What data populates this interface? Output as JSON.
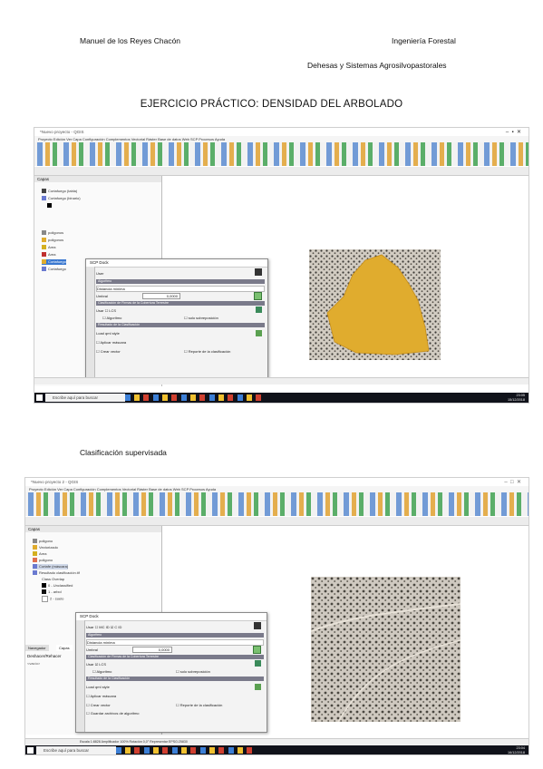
{
  "header": {
    "author": "Manuel de los Reyes Chacón",
    "degree": "Ingeniería Forestal",
    "course": "Dehesas y Sistemas Agrosilvopastorales"
  },
  "title": "EJERCICIO PRÁCTICO: DENSIDAD DEL ARBOLADO",
  "section_caption": "Clasificación supervisada",
  "screenshot1": {
    "window_title": "*Nuevo proyecto - QGIS",
    "menu": "Proyecto  Edición  Ver  Capa  Configuración  Complementos  Vectorial  Ráster  Base de datos  Web  SCP  Procesos  Ayuda",
    "panel_title": "Capas",
    "layers": [
      "Cortafuego (tabla)",
      "Cortafuego (binario)",
      "Area",
      "poligonos",
      "poligonos",
      "Area",
      "Cortafuego",
      "Cortafuego"
    ],
    "dialog_title": "SCP Dock",
    "dialog": {
      "user_label": "User",
      "algorithm_section": "Algoritmo",
      "algorithm_value": "Distancia mínima",
      "threshold_label": "Umbral",
      "threshold_value": "0,0000",
      "training_section": "Clasificación de Firmas de la Cobertura Terrestre",
      "use_label": "Usar",
      "lcs_label": "LCS",
      "algorithm_cb": "Algoritmo",
      "overlap_cb": "solo sobreposición",
      "result_section": "Resultado de la Clasificación",
      "load_style": "Load qml style",
      "mask_cb": "Aplicar máscara",
      "vector_cb": "Crear vector",
      "report_cb": "Reporte de la clasificación"
    },
    "taskbar_search": "Escribe aquí para buscar",
    "clock": [
      "23:05",
      "15/12/2018"
    ]
  },
  "screenshot2": {
    "window_title": "*Nuevo proyecto 2 - QGIS",
    "menu": "Proyecto  Edición  Ver  Capa  Configuración  Complementos  Vectorial  Ráster  Base de datos  Web  SCP  Procesos  Ayuda",
    "panel_title": "Capas",
    "layers": [
      "poligono",
      "Vectorizado",
      "Area",
      "poligono",
      "Cortafe (máscara)",
      "Resultado clasificación.tif",
      "Class Overlap",
      "0 - Unclassified",
      "1 - arbol",
      "2 - suelo"
    ],
    "tabs": [
      "Navegador",
      "Capas"
    ],
    "panel2_title": "Deshacer/Rehacer",
    "panel2_item": "<vacío>",
    "dialog_title": "SCP Dock",
    "dialog": {
      "user_label": "Usar",
      "mc_id": "MC ID",
      "c_id": "C ID",
      "algorithm_section": "Algoritmo",
      "algorithm_value": "Distancia mínima",
      "threshold_label": "Umbral",
      "threshold_value": "0,0000",
      "training_section": "Clasificación de Firmas de la Cobertura Terrestre",
      "use_label": "Usar",
      "lcs_label": "LCS",
      "algorithm_cb": "Algoritmo",
      "overlap_cb": "solo sobreposición",
      "result_section": "Resultado de la Clasificación",
      "load_style": "Load qml style",
      "mask_cb": "Aplicar máscara",
      "vector_cb": "Crear vector",
      "report_cb": "Reporte de la clasificación",
      "save_cb": "Guardar archivos de algoritmo"
    },
    "status": "Escala 1:8828   Amplificador 100%   Rotación 0,0°   Representar   EPSG:25830",
    "taskbar_search": "Escribe aquí para buscar",
    "clock": [
      "23:04",
      "16/12/2018"
    ]
  },
  "colors": {
    "polygon_fill": "#e0ac2e",
    "aerial_base": "#cfc9c0",
    "dialog_section": "#7a7a8a",
    "taskbar": "#10121a"
  }
}
